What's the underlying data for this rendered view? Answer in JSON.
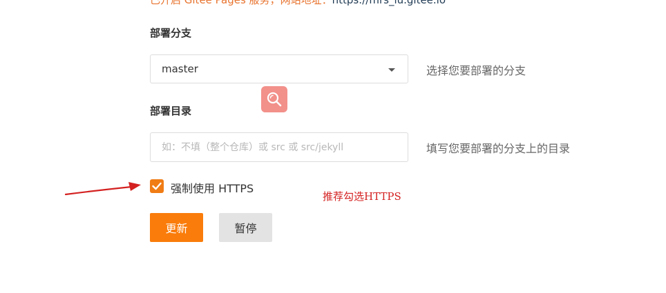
{
  "top_notice": {
    "prefix": "已开启 Gitee Pages 服务，网站地址：",
    "url": "https://mrs_lu.gitee.io"
  },
  "branch": {
    "label": "部署分支",
    "selected": "master",
    "help": "选择您要部署的分支"
  },
  "directory": {
    "label": "部署目录",
    "placeholder": "如：不填（整个仓库）或 src 或 src/jekyll",
    "value": "",
    "help": "填写您要部署的分支上的目录"
  },
  "force_https": {
    "label": "强制使用 HTTPS",
    "checked": true
  },
  "annotation": {
    "text": "推荐勾选HTTPS",
    "color": "#d42020"
  },
  "buttons": {
    "update": "更新",
    "pause": "暂停"
  },
  "colors": {
    "accent": "#fa7c0a",
    "search_fab": "#f2908a"
  },
  "icons": {
    "search_fab": "search-icon",
    "dropdown": "caret-down-icon",
    "checkbox": "check-icon",
    "annotation_arrow": "arrow-right-icon"
  }
}
